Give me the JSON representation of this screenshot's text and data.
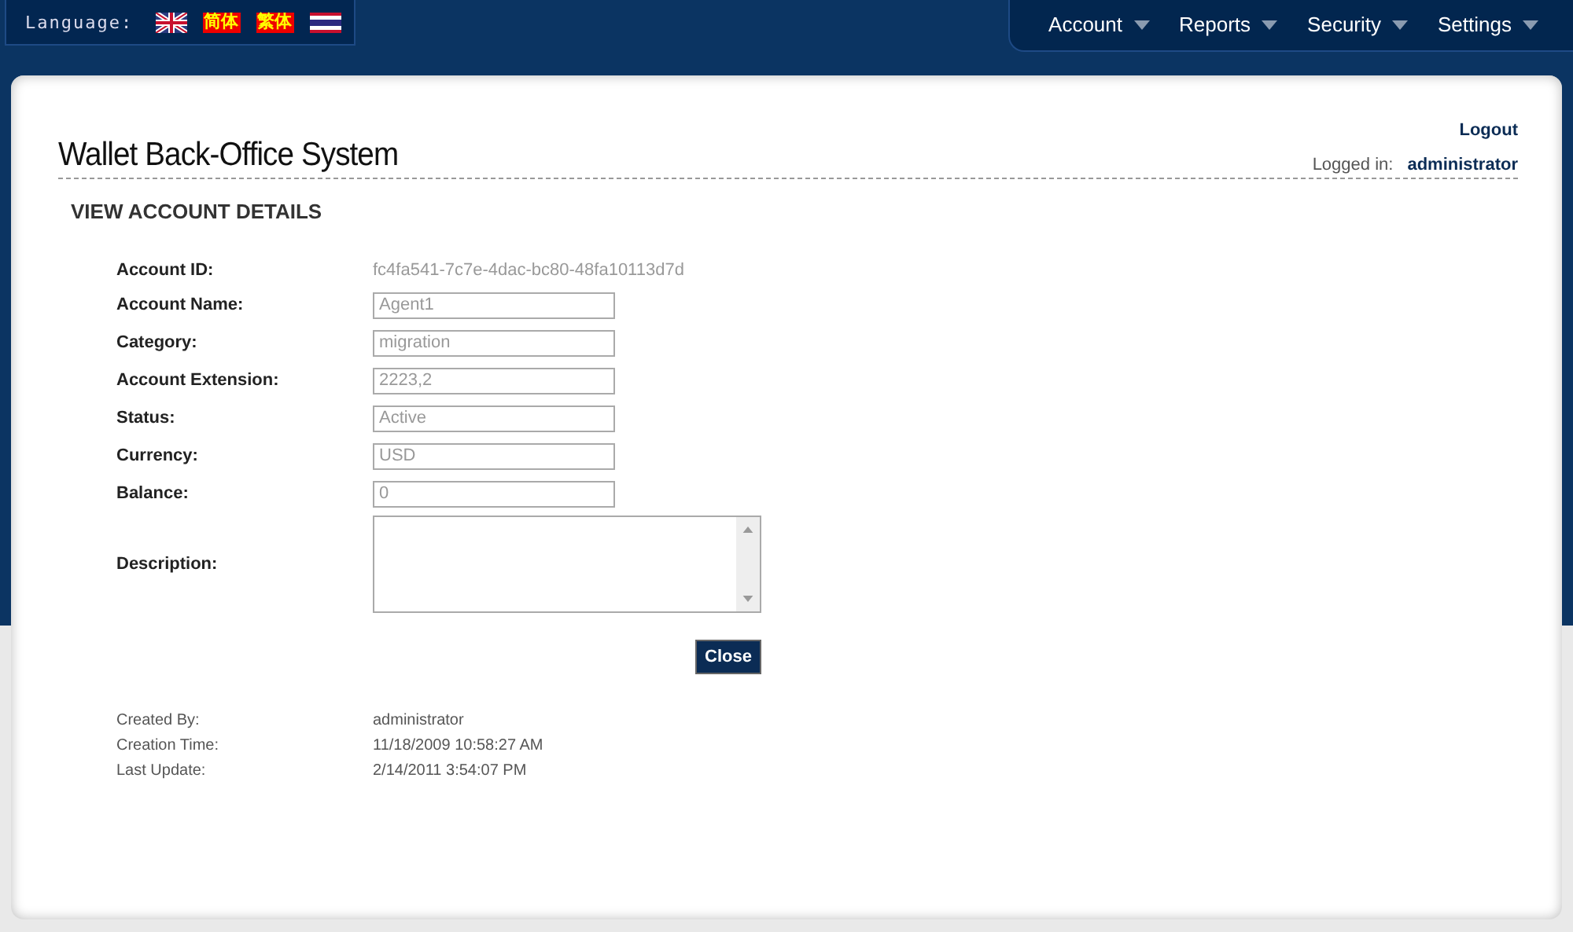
{
  "language": {
    "label": "Language:",
    "options": [
      {
        "kind": "uk-flag"
      },
      {
        "kind": "text",
        "label": "简体"
      },
      {
        "kind": "text",
        "label": "繁体"
      },
      {
        "kind": "thai-flag"
      }
    ]
  },
  "menu": [
    "Account",
    "Reports",
    "Security",
    "Settings"
  ],
  "header": {
    "title": "Wallet Back-Office System",
    "logout": "Logout",
    "logged_in_label": "Logged in:",
    "user": "administrator"
  },
  "section_title": "VIEW ACCOUNT DETAILS",
  "fields": [
    {
      "kind": "text",
      "label": "Account ID:",
      "value": "fc4fa541-7c7e-4dac-bc80-48fa10113d7d"
    },
    {
      "kind": "input",
      "label": "Account Name:",
      "value": "Agent1"
    },
    {
      "kind": "input",
      "label": "Category:",
      "value": "migration"
    },
    {
      "kind": "input",
      "label": "Account Extension:",
      "value": "2223,2"
    },
    {
      "kind": "input",
      "label": "Status:",
      "value": "Active"
    },
    {
      "kind": "input",
      "label": "Currency:",
      "value": "USD"
    },
    {
      "kind": "input",
      "label": "Balance:",
      "value": "0"
    },
    {
      "kind": "textarea",
      "label": "Description:"
    }
  ],
  "close_button": "Close",
  "audit": [
    {
      "label": "Created By:",
      "value": "administrator"
    },
    {
      "label": "Creation Time:",
      "value": "11/18/2009 10:58:27 AM"
    },
    {
      "label": "Last Update:",
      "value": "2/14/2011 3:54:07 PM"
    }
  ]
}
